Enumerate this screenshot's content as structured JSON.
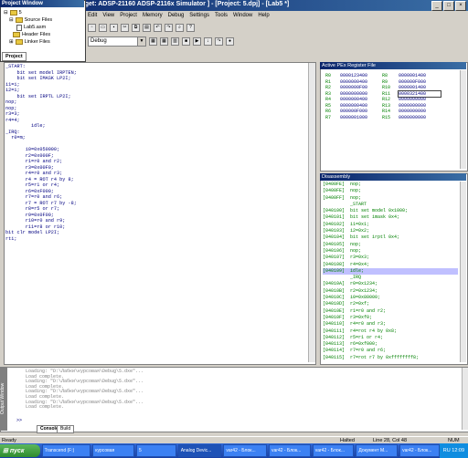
{
  "window": {
    "title": "rget: ADSP-21160 ADSP-2116x Simulator ] - [Project: 5.dpj] - [Lab5 *]",
    "min": "_",
    "max": "□",
    "close": "×"
  },
  "menu": [
    "Edit",
    "View",
    "Project",
    "Memory",
    "Debug",
    "Settings",
    "Tools",
    "Window",
    "Help"
  ],
  "toolbar": {
    "config": "Debug"
  },
  "project_window": {
    "title": "Project Window",
    "root": "5",
    "items": [
      "Source Files",
      "Lab5.asm",
      "Header Files",
      "Linker Files"
    ],
    "tab": "Project"
  },
  "editor": {
    "lines": [
      "_START:",
      "    bit set model IRPTEN;",
      "    bit set IMASK LP2I;",
      "i1=i;",
      "i2=i;",
      "    bit set IRPTL LP2I;",
      "nop;",
      "nop;",
      "r3=3;",
      "r4=4;",
      "         idle;",
      "_IRQ:",
      "  r0=m;",
      "",
      "       i0=0x050000;",
      "       r2=0x000F;",
      "       r1=r0 and r2;",
      "       r3=0x00F0;",
      "       r4=r0 and r3;",
      "       r4 = ROT r4 by 8;",
      "       r5=r1 or r4;",
      "       r6=0xF000;",
      "       r7=r0 and r6;",
      "       r7 = ROT r7 by -8;",
      "       r8=r5 or r7;",
      "       r9=0x0F00;",
      "       r10=r0 and r9;",
      "       r11=r8 or r10;",
      "bit clr model LP2I;",
      "rti;"
    ]
  },
  "registers": {
    "title": "Active PEx Register File",
    "rows": [
      [
        "R0",
        "0000123400",
        "R8",
        "0000001400"
      ],
      [
        "R1",
        "0000000400",
        "R9",
        "000000F000"
      ],
      [
        "R2",
        "0000000F00",
        "R10",
        "0000001400"
      ],
      [
        "R3",
        "0000000000",
        "R11",
        "0000321400"
      ],
      [
        "R4",
        "0000000400",
        "R12",
        "0000000000"
      ],
      [
        "R5",
        "0000000400",
        "R13",
        "0000000000"
      ],
      [
        "R6",
        "000000F000",
        "R14",
        "0000000000"
      ],
      [
        "R7",
        "0000001000",
        "R15",
        "0000000000"
      ]
    ]
  },
  "disassembly": {
    "title": "Disassembly",
    "lines": [
      "[0400FE]  nop;",
      "[0400FE]  nop;",
      "[0400FF]  nop;",
      "          _START",
      "[040100]  bit set model 0x1000;",
      "[040101]  bit set imask 0x4;",
      "[040102]  i1=0x1;",
      "[040103]  i2=0x2;",
      "[040104]  bit set irptl 0x4;",
      "[040105]  nop;",
      "[040106]  nop;",
      "[040107]  r3=0x3;",
      "[040108]  r4=0x4;",
      "[040109]  idle;",
      "          _IRQ",
      "[04010A]  r0=0x1234;",
      "[04010B]  r2=0x1234;",
      "[04010C]  i0=0x80000;",
      "[04010D]  r2=0xf;",
      "[04010E]  r1=r0 and r2;",
      "[04010F]  r3=0xf0;",
      "[040110]  r4=r0 and r3;",
      "[040111]  r4=rot r4 by 0x8;",
      "[040112]  r5=r1 or r4;",
      "[040113]  r6=0xf000;",
      "[040114]  r7=r0 and r6;",
      "[040115]  r7=rot r7 by 0xffffffff8;"
    ]
  },
  "output": {
    "side_label": "Output Window",
    "lines": [
      "Loading: \"D:\\Лабки\\курсовая\\Debug\\5.dxe\"...",
      "Load complete.",
      "Loading: \"D:\\Лабки\\курсовая\\Debug\\5.dxe\"...",
      "Load complete.",
      "Loading: \"D:\\Лабки\\курсовая\\Debug\\5.dxe\"...",
      "Load complete.",
      "Loading: \"D:\\Лабки\\курсовая\\Debug\\5.dxe\"...",
      "Load complete."
    ],
    "prompt": ">>",
    "tabs": [
      "Console",
      "Build"
    ]
  },
  "status": {
    "left": "Ready",
    "halted": "Halted",
    "pos": "Line 28, Col 48",
    "mode": "NUM"
  },
  "taskbar": {
    "start": "пуск",
    "tasks": [
      "Transcend (F:)",
      "курсовая",
      "5",
      "Analog Devic...",
      "var42 - Блок...",
      "var42 - Блок...",
      "var42 - Блок...",
      "Документ М...",
      "var42 - Блок..."
    ],
    "tray": "RU",
    "time": "12:09"
  }
}
